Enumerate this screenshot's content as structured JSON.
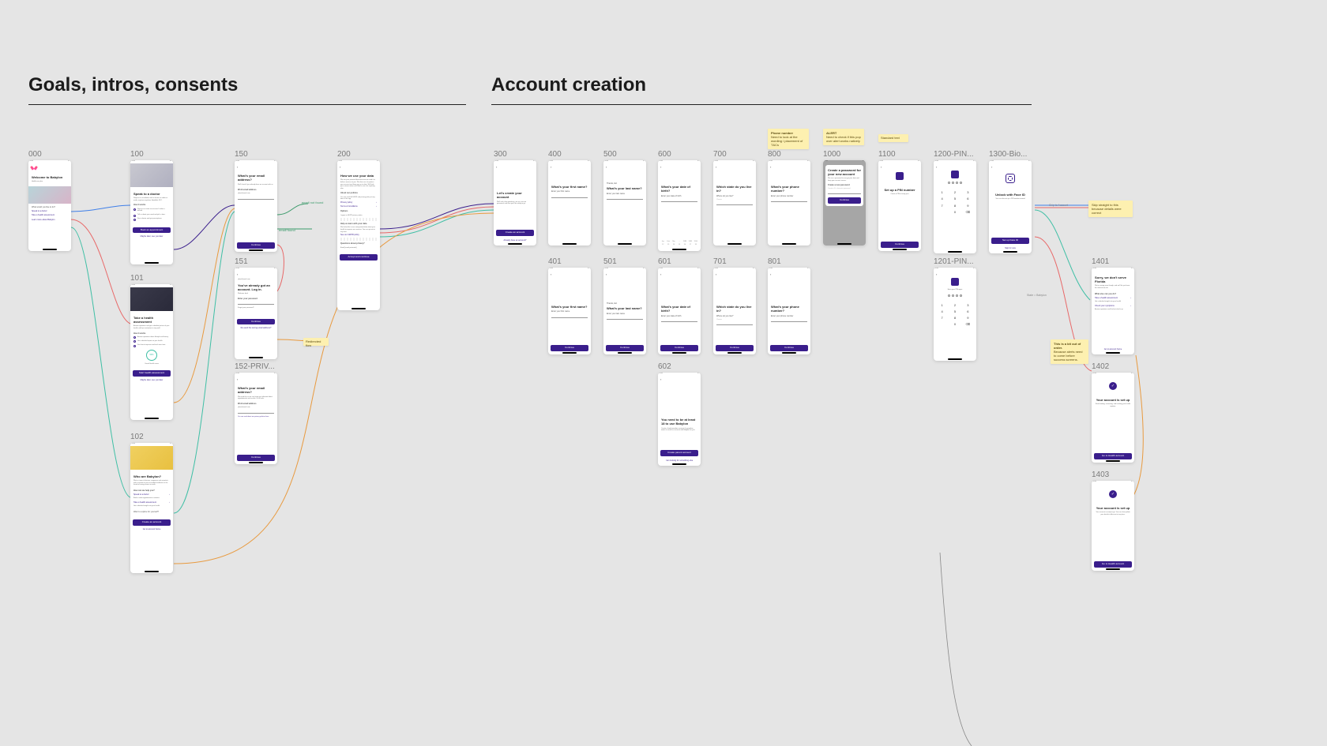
{
  "sections": {
    "goals": {
      "title": "Goals, intros, consents"
    },
    "account": {
      "title": "Account creation"
    }
  },
  "labels": {
    "s000": "000",
    "s100": "100",
    "s101": "101",
    "s102": "102",
    "s150": "150",
    "s151": "151",
    "s152": "152-PRIV...",
    "s200": "200",
    "s300": "300",
    "s400": "400",
    "s401": "401",
    "s500": "500",
    "s501": "501",
    "s600": "600",
    "s601": "601",
    "s602": "602",
    "s700": "700",
    "s701": "701",
    "s800": "800",
    "s801": "801",
    "s1000": "1000",
    "s1100": "1100",
    "s1200": "1200-PIN...",
    "s1201": "1201-PIN...",
    "s1300": "1300-Bio...",
    "s1401": "1401",
    "s1402": "1402",
    "s1403": "1403"
  },
  "annotations": {
    "email_not_found": "email not found",
    "email_found": "email found",
    "redirected_flow": "Redirected flow",
    "skip_to_account": "Skip to Account",
    "state_babylon": "State = Babylon"
  },
  "stickies": {
    "phone": {
      "title": "Phone number",
      "body": "Need to look at the wording / placement of T&Cs"
    },
    "alert": {
      "title": "ALERT",
      "body": "Need to check if this pop over alert works natively"
    },
    "standard": {
      "text": "Standard text"
    },
    "skip": {
      "text": "Skip straight to this because details were correct"
    },
    "order": {
      "title": "This is a bit out of order.",
      "body": "Because alerts need to come before success screens."
    }
  },
  "screens": {
    "s000_title": "Welcome to Babylon",
    "s000_sub": "Healthcare plan",
    "s000_q": "What would you like to do?",
    "speak_doctor": "Speak to a doctor",
    "take_health": "Take a health assessment",
    "learn_more": "Learn more about Babylon",
    "book_appt": "Book an appointment",
    "start_health": "Start health assessment",
    "see_later": "Maybe later, see you later",
    "who_babylon": "Who are Babylon?",
    "how_help": "How can we help you?",
    "want_explore": "Want to explore for yourself?",
    "create_account": "Create an account",
    "go_to_account": "Go to account home",
    "email_q": "What's your email address?",
    "email_label": "Work email address",
    "email_placeholder": "j.doe@email.com",
    "continue": "Continue",
    "already_title": "You've already got an account. Log in.",
    "password_label": "Enter your password",
    "forgot": "Forgot your password?",
    "resend_wrong": "Re-send the wrong email address?",
    "how_data": "How we use your data",
    "about_privacy": "About our policies",
    "options": "Options",
    "agree_privacy": "I agree to GDPR privacy notice",
    "help_learn": "Help us learn with your data",
    "see_gdpr": "See our GDPR policy",
    "questions": "Questions about privacy?",
    "lets_create": "Let's create your account",
    "already_have": "Already have an account?",
    "first_name_q": "What's your first name?",
    "first_name_label": "Enter your first name",
    "thanks_ed": "Thanks, Ed.",
    "last_name_q": "What's your last name?",
    "last_name_label": "Enter your last name",
    "dob_q": "What's your date of birth?",
    "dob_label": "Enter your date of birth",
    "region_q": "Which state do you live in?",
    "region_label": "Where do you live?",
    "region_placeholder": "Choose",
    "phone_q": "What's your phone number?",
    "phone_label": "Enter your phone number",
    "too_young": "You need to be at least 18 to use Babylon",
    "create_parent": "Create parent account",
    "something_else": "I am looking for something else",
    "create_pw_title": "Create a password for your new account",
    "pw_label": "Create a new password",
    "pw_hint": "Create a 8+ character password",
    "pin_title": "Set up a PIN number",
    "pin_sub": "Create a PIN to keep your",
    "faceid_title": "Unlock with Face ID",
    "faceid_hint": "You can also set up a PIN number instead",
    "set_faceid": "Set up Face ID",
    "skip_now": "Skip for now",
    "enter_pin": "Enter your PIN again",
    "sorry_florida": "Sorry, we don't serve Florida",
    "what_else": "What else can you do?",
    "check_symptoms": "Check your symptoms",
    "account_setup": "Your account is set up",
    "go_account": "Go to Health account"
  }
}
